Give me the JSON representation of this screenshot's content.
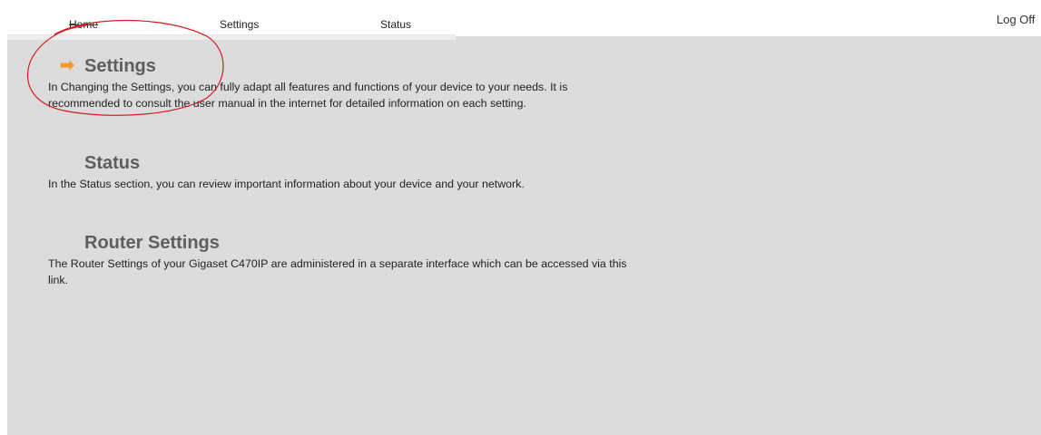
{
  "nav": {
    "home_label": "Home",
    "settings_label": "Settings",
    "status_label": "Status",
    "logoff_label": "Log Off"
  },
  "sections": [
    {
      "title": "Settings",
      "description": "In Changing the Settings, you can fully adapt all features and functions of your device to your needs. It is recommended to consult the user manual in the internet for detailed information on each setting.",
      "active": true,
      "icon": "arrow-right-icon"
    },
    {
      "title": "Status",
      "description": "In the Status section, you can review important information about your device and your network."
    },
    {
      "title": "Router Settings",
      "description": "The Router Settings of your Gigaset C470IP are administered in a separate interface which can be accessed via this link."
    }
  ],
  "colors": {
    "panel_background": "#dcdcdc",
    "title_text": "#5e5e5e",
    "arrow_accent": "#f39a2d",
    "annotation_red": "#d21f1f"
  }
}
